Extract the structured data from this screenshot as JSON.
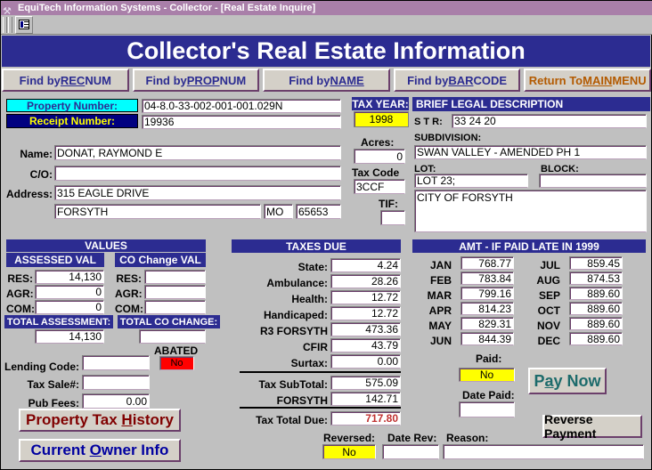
{
  "window": {
    "title": "EquiTech Information Systems - Collector - [Real Estate Inquire]",
    "icon": "app-icon",
    "toolbar_button_icon": "form-view-icon"
  },
  "banner": {
    "title": "Collector's Real Estate Information"
  },
  "find_buttons": [
    {
      "name": "find-by-rec-num",
      "pre": "Find by ",
      "accel": "REC",
      "post": " NUM"
    },
    {
      "name": "find-by-prop-num",
      "pre": "Find by ",
      "accel": "PROP",
      "post": " NUM"
    },
    {
      "name": "find-by-name",
      "pre": "Find by ",
      "accel": "NAME",
      "post": ""
    },
    {
      "name": "find-by-bar-code",
      "pre": "Find by ",
      "accel": "BAR",
      "post": " CODE"
    },
    {
      "name": "return-to-main-menu",
      "pre": "Return To ",
      "accel": "MAIN",
      "post": " MENU"
    }
  ],
  "property": {
    "property_number_label": "Property Number:",
    "property_number_value": "04-8.0-33-002-001-001.029N",
    "receipt_number_label": "Receipt Number:",
    "receipt_number_value": "19936",
    "name_label": "Name:",
    "name_value": "DONAT, RAYMOND E",
    "co_label": "C/O:",
    "co_value": "",
    "address_label": "Address:",
    "address_value": "315 EAGLE DRIVE",
    "city_value": "FORSYTH",
    "state_value": "MO",
    "zip_value": "65653"
  },
  "taxyear": {
    "label": "TAX YEAR:",
    "value": "1998",
    "acres_label": "Acres:",
    "acres_value": "0",
    "taxcode_label": "Tax Code",
    "taxcode_value": "3CCF",
    "tif_label": "TIF:",
    "tif_value": ""
  },
  "legal": {
    "header": "BRIEF LEGAL DESCRIPTION",
    "str_label": "S  T  R:",
    "str_value": "33 24 20",
    "subdivision_label": "SUBDIVISION:",
    "subdivision_value": "SWAN VALLEY - AMENDED PH 1",
    "lot_label": "LOT:",
    "lot_value": "LOT 23;",
    "block_label": "BLOCK:",
    "block_value": "",
    "notes_value": "CITY OF FORSYTH"
  },
  "values": {
    "header": "VALUES",
    "assessed_header": "ASSESSED  VAL",
    "cochange_header": "CO Change VAL",
    "rows": [
      {
        "label": "RES:",
        "assessed": "14,130",
        "cochange": ""
      },
      {
        "label": "AGR:",
        "assessed": "0",
        "cochange": ""
      },
      {
        "label": "COM:",
        "assessed": "0",
        "cochange": ""
      }
    ],
    "total_assessment_label": "TOTAL ASSESSMENT:",
    "total_assessment_value": "14,130",
    "total_cochange_label": "TOTAL CO CHANGE:",
    "total_cochange_value": ""
  },
  "taxes_due": {
    "header": "TAXES DUE",
    "rows": [
      {
        "label": "State:",
        "value": "4.24"
      },
      {
        "label": "Ambulance:",
        "value": "28.26"
      },
      {
        "label": "Health:",
        "value": "12.72"
      },
      {
        "label": "Handicaped:",
        "value": "12.72"
      },
      {
        "label": "R3  FORSYTH",
        "value": "473.36"
      },
      {
        "label": "CFIR",
        "value": "43.79"
      },
      {
        "label": "Surtax:",
        "value": "0.00"
      }
    ],
    "subtotal_label": "Tax SubTotal:",
    "subtotal_value": "575.09",
    "city_label": "FORSYTH",
    "city_value": "142.71",
    "total_label": "Tax Total Due:",
    "total_value": "717.80",
    "total_color": "#c03030"
  },
  "late_amounts": {
    "header": "AMT - IF PAID LATE IN 1999",
    "left": [
      {
        "month": "JAN",
        "amount": "768.77"
      },
      {
        "month": "FEB",
        "amount": "783.84"
      },
      {
        "month": "MAR",
        "amount": "799.16"
      },
      {
        "month": "APR",
        "amount": "814.23"
      },
      {
        "month": "MAY",
        "amount": "829.31"
      },
      {
        "month": "JUN",
        "amount": "844.39"
      }
    ],
    "right": [
      {
        "month": "JUL",
        "amount": "859.45"
      },
      {
        "month": "AUG",
        "amount": "874.53"
      },
      {
        "month": "SEP",
        "amount": "889.60"
      },
      {
        "month": "OCT",
        "amount": "889.60"
      },
      {
        "month": "NOV",
        "amount": "889.60"
      },
      {
        "month": "DEC",
        "amount": "889.60"
      }
    ]
  },
  "lending": {
    "lending_code_label": "Lending Code:",
    "lending_code_value": "",
    "tax_sale_label": "Tax Sale#:",
    "tax_sale_value": "",
    "pub_fees_label": "Pub Fees:",
    "pub_fees_value": "0.00",
    "abated_label": "ABATED",
    "abated_value": "No",
    "abated_color": "#ff0000"
  },
  "actions": {
    "property_tax_history": {
      "pre": "Property Tax ",
      "accel": "H",
      "post": "istory",
      "color": "#800000"
    },
    "current_owner_info": {
      "pre": "Current ",
      "accel": "O",
      "post": "wner Info",
      "color": "#0000a0"
    },
    "pay_now": {
      "pre": "P",
      "accel": "a",
      "post": "y Now",
      "color": "#1d6b6b"
    },
    "reverse_payment": "Reverse Payment"
  },
  "payment": {
    "paid_label": "Paid:",
    "paid_value": "No",
    "date_paid_label": "Date Paid:",
    "date_paid_value": "",
    "reversed_label": "Reversed:",
    "reversed_value": "No",
    "date_rev_label": "Date Rev:",
    "date_rev_value": "",
    "reason_label": "Reason:",
    "reason_value": ""
  },
  "colors": {
    "banner": "#2c2c91",
    "titlebar": "#a97fa9",
    "highlight_yellow": "#ffff00",
    "highlight_cyan": "#00ffff",
    "face": "#c0c0c0"
  }
}
